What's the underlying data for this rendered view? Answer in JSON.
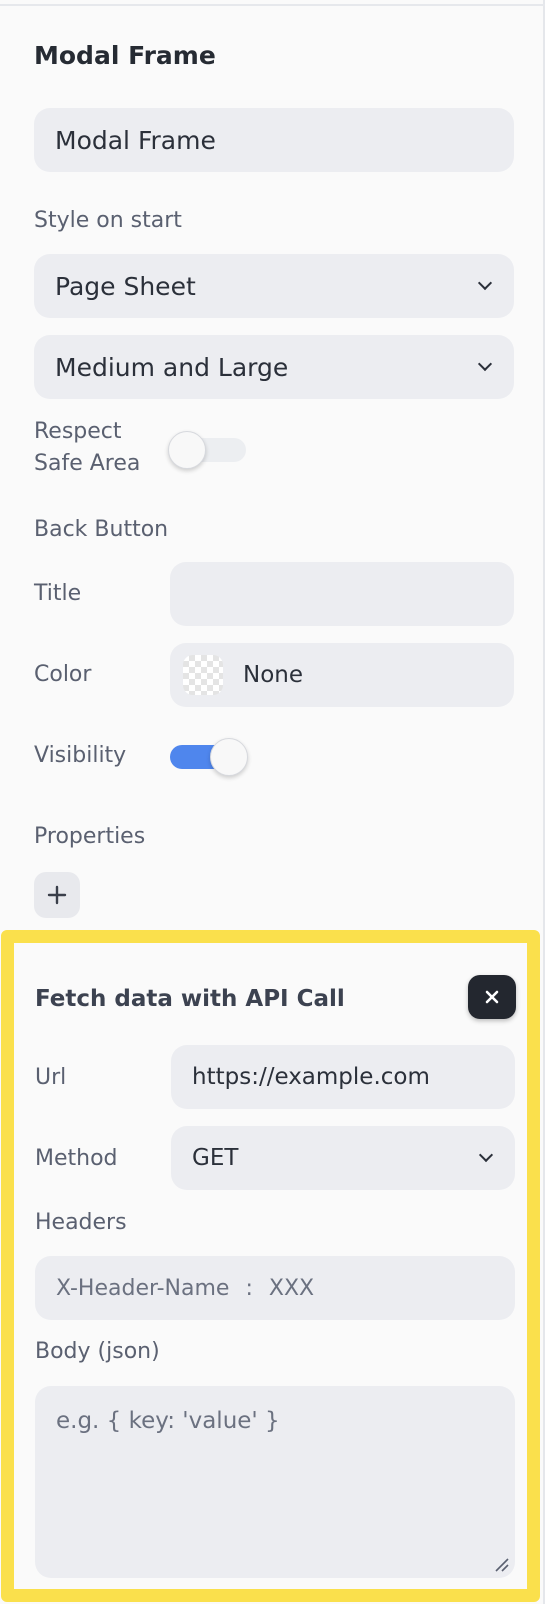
{
  "modal": {
    "title": "Modal Frame",
    "name_value": "Modal Frame",
    "style_label": "Style on start",
    "style_value": "Page Sheet",
    "detents_value": "Medium and Large",
    "safe_area_label_line1": "Respect",
    "safe_area_label_line2": "Safe Area",
    "safe_area_enabled": false
  },
  "back_button": {
    "heading": "Back Button",
    "title_label": "Title",
    "title_value": "",
    "color_label": "Color",
    "color_value": "None",
    "visibility_label": "Visibility",
    "visibility_enabled": true
  },
  "properties": {
    "label": "Properties",
    "add_label": "+"
  },
  "api_call": {
    "title": "Fetch data with API Call",
    "close_label": "×",
    "url_label": "Url",
    "url_value": "https://example.com",
    "method_label": "Method",
    "method_value": "GET",
    "headers_label": "Headers",
    "header_name_placeholder": "X-Header-Name",
    "header_separator": ":",
    "header_value_placeholder": "XXX",
    "body_label": "Body (json)",
    "body_placeholder": "e.g. { key: 'value' }"
  },
  "colors": {
    "toggle_on": "#4f86ed",
    "toggle_off": "#eceef1",
    "highlight": "#fae04c",
    "field_bg": "#ecedf1"
  }
}
